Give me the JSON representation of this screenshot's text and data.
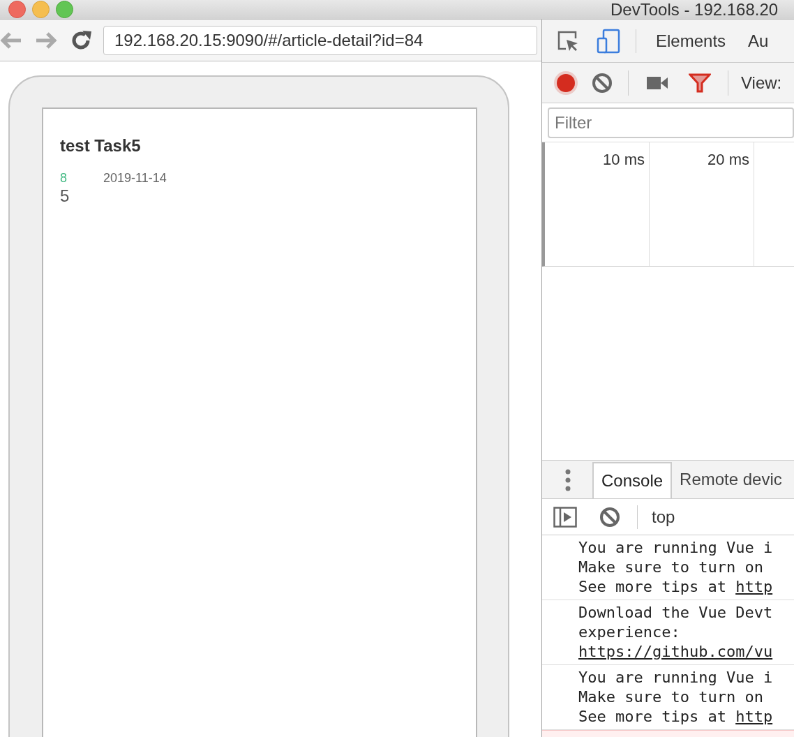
{
  "browser": {
    "url": "192.168.20.15:9090/#/article-detail?id=84"
  },
  "article": {
    "title": "test Task5",
    "count": "8",
    "date": "2019-11-14",
    "body": "5"
  },
  "devtools": {
    "title": "DevTools - 192.168.20",
    "panel_tabs": [
      {
        "label": "Elements",
        "selected": false
      },
      {
        "label": "Au",
        "selected": false
      }
    ],
    "device_mode": {
      "on": true
    },
    "recording": {
      "on": true
    },
    "view_label": "View:",
    "filter": {
      "placeholder": "Filter"
    },
    "timeline_ticks": [
      "10 ms",
      "20 ms"
    ],
    "drawer_tabs": [
      {
        "label": "Console",
        "selected": true
      },
      {
        "label": "Remote devic",
        "selected": false
      }
    ],
    "context": "top",
    "messages": [
      {
        "lines": [
          {
            "kind": "plain",
            "text": "You are running Vue i"
          },
          {
            "kind": "plain",
            "text": "Make sure to turn on"
          },
          {
            "kind": "mixed",
            "text": "See more tips at ",
            "link": "http"
          }
        ]
      },
      {
        "lines": [
          {
            "kind": "plain",
            "text": "Download the Vue Devt"
          },
          {
            "kind": "plain",
            "text": "experience:"
          },
          {
            "kind": "link",
            "text": "https://github.com/vu"
          }
        ]
      },
      {
        "lines": [
          {
            "kind": "plain",
            "text": "You are running Vue i"
          },
          {
            "kind": "plain",
            "text": "Make sure to turn on"
          },
          {
            "kind": "mixed",
            "text": "See more tips at ",
            "link": "http"
          }
        ]
      }
    ]
  }
}
